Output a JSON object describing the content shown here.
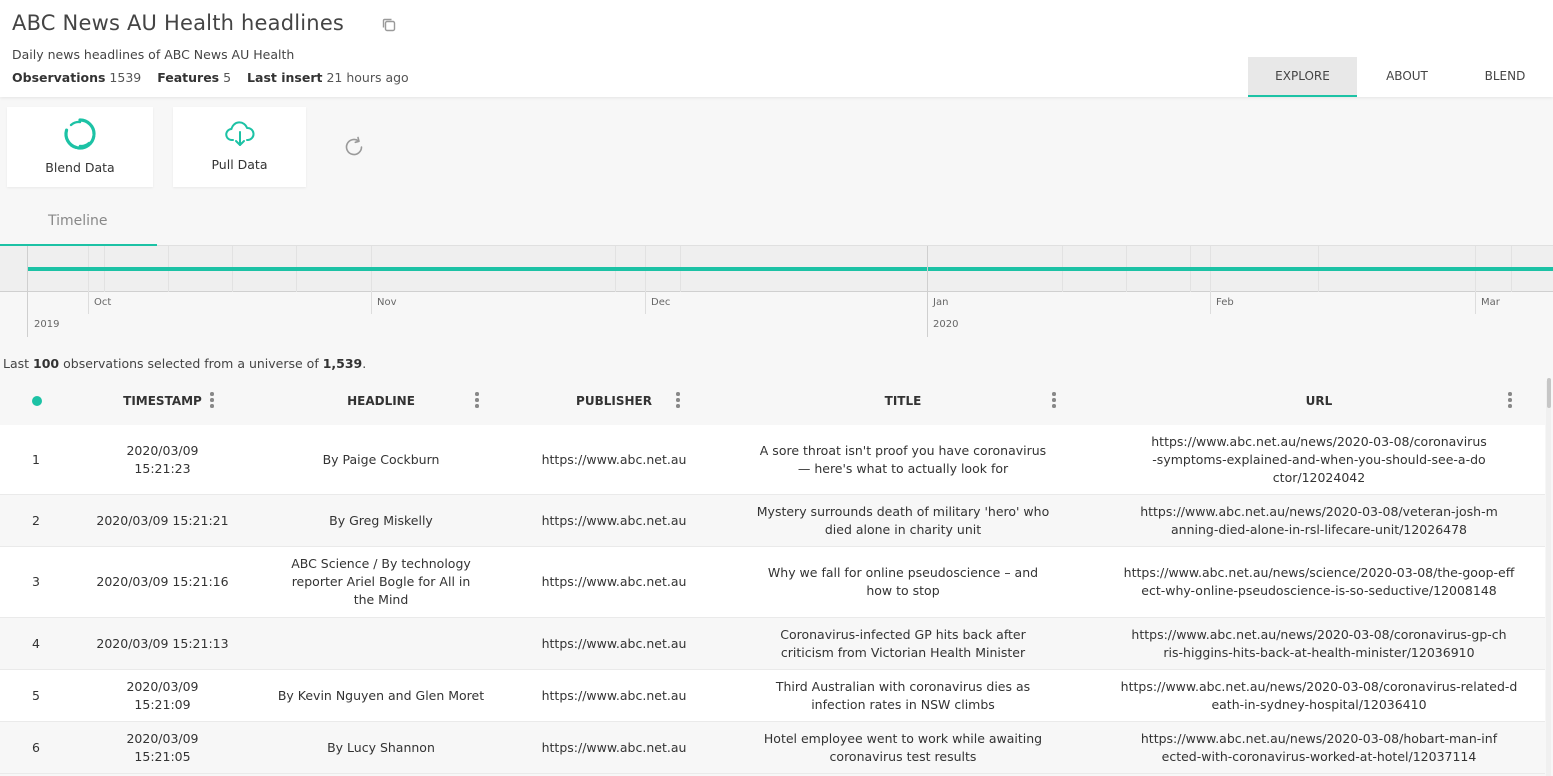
{
  "header": {
    "title": "ABC News AU Health headlines",
    "subtitle": "Daily news headlines of ABC News AU Health",
    "stats": {
      "observations_label": "Observations",
      "observations_value": "1539",
      "features_label": "Features",
      "features_value": "5",
      "last_insert_label": "Last insert",
      "last_insert_value": "21 hours ago"
    },
    "nav": [
      "EXPLORE",
      "ABOUT",
      "BLEND"
    ],
    "nav_active": "EXPLORE"
  },
  "actions": {
    "blend_label": "Blend Data",
    "pull_label": "Pull Data"
  },
  "timeline": {
    "tab_label": "Timeline",
    "months": [
      "Oct",
      "Nov",
      "Dec",
      "Jan",
      "Feb",
      "Mar"
    ],
    "years": [
      "2019",
      "2020"
    ]
  },
  "selection": {
    "prefix": "Last",
    "count": "100",
    "middle": "observations selected from a universe of",
    "total": "1,539",
    "suffix": "."
  },
  "table": {
    "columns": [
      "TIMESTAMP",
      "HEADLINE",
      "PUBLISHER",
      "TITLE",
      "URL"
    ],
    "rows": [
      {
        "idx": "1",
        "timestamp": "2020/03/09 15:21:23",
        "headline": "By Paige Cockburn",
        "publisher": "https://www.abc.net.au",
        "title": "A sore throat isn't proof you have coronavirus — here's what to actually look for",
        "url": "https://www.abc.net.au/news/2020-03-08/coronavirus-symptoms-explained-and-when-you-should-see-a-doctor/12024042"
      },
      {
        "idx": "2",
        "timestamp": "2020/03/09 15:21:21",
        "headline": "By Greg Miskelly",
        "publisher": "https://www.abc.net.au",
        "title": "Mystery surrounds death of military 'hero' who died alone in charity unit",
        "url": "https://www.abc.net.au/news/2020-03-08/veteran-josh-manning-died-alone-in-rsl-lifecare-unit/12026478"
      },
      {
        "idx": "3",
        "timestamp": "2020/03/09 15:21:16",
        "headline": "ABC Science / By technology reporter Ariel Bogle for All in the Mind",
        "publisher": "https://www.abc.net.au",
        "title": "Why we fall for online pseudoscience – and how to stop",
        "url": "https://www.abc.net.au/news/science/2020-03-08/the-goop-effect-why-online-pseudoscience-is-so-seductive/12008148"
      },
      {
        "idx": "4",
        "timestamp": "2020/03/09 15:21:13",
        "headline": "",
        "publisher": "https://www.abc.net.au",
        "title": "Coronavirus-infected GP hits back after criticism from Victorian Health Minister",
        "url": "https://www.abc.net.au/news/2020-03-08/coronavirus-gp-chris-higgins-hits-back-at-health-minister/12036910"
      },
      {
        "idx": "5",
        "timestamp": "2020/03/09 15:21:09",
        "headline": "By Kevin Nguyen and Glen Moret",
        "publisher": "https://www.abc.net.au",
        "title": "Third Australian with coronavirus dies as infection rates in NSW climbs",
        "url": "https://www.abc.net.au/news/2020-03-08/coronavirus-related-death-in-sydney-hospital/12036410"
      },
      {
        "idx": "6",
        "timestamp": "2020/03/09 15:21:05",
        "headline": "By Lucy Shannon",
        "publisher": "https://www.abc.net.au",
        "title": "Hotel employee went to work while awaiting coronavirus test results",
        "url": "https://www.abc.net.au/news/2020-03-08/hobart-man-infected-with-coronavirus-worked-at-hotel/12037114"
      }
    ]
  },
  "colors": {
    "accent": "#1cc2a5"
  },
  "icons": [
    "copy-icon",
    "blend-icon",
    "cloud-download-icon",
    "refresh-icon",
    "kebab-icon"
  ]
}
